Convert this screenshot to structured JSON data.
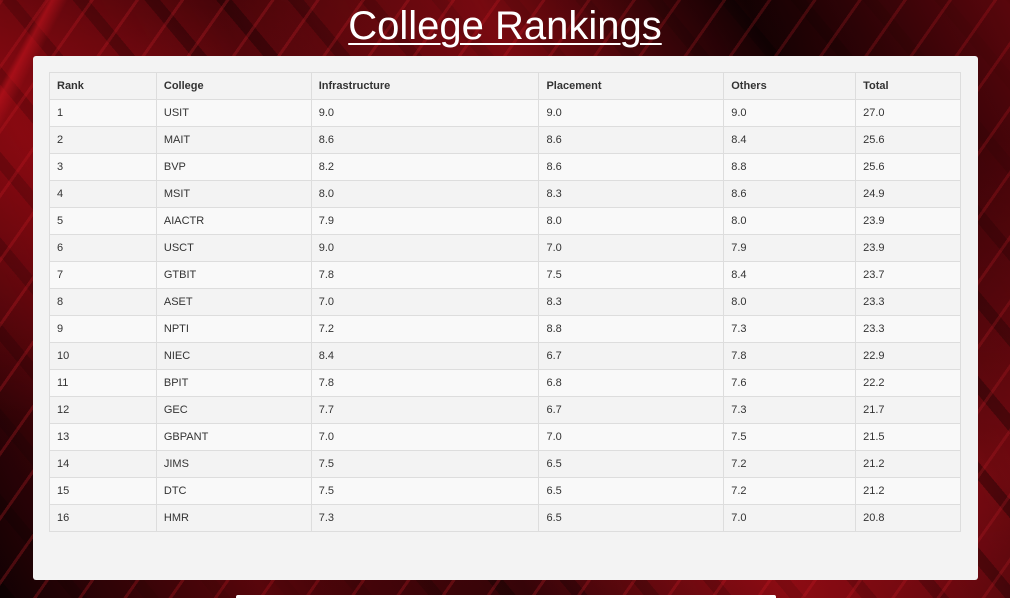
{
  "page": {
    "title": "College Rankings"
  },
  "table": {
    "headers": [
      "Rank",
      "College",
      "Infrastructure",
      "Placement",
      "Others",
      "Total"
    ],
    "rows": [
      [
        "1",
        "USIT",
        "9.0",
        "9.0",
        "9.0",
        "27.0"
      ],
      [
        "2",
        "MAIT",
        "8.6",
        "8.6",
        "8.4",
        "25.6"
      ],
      [
        "3",
        "BVP",
        "8.2",
        "8.6",
        "8.8",
        "25.6"
      ],
      [
        "4",
        "MSIT",
        "8.0",
        "8.3",
        "8.6",
        "24.9"
      ],
      [
        "5",
        "AIACTR",
        "7.9",
        "8.0",
        "8.0",
        "23.9"
      ],
      [
        "6",
        "USCT",
        "9.0",
        "7.0",
        "7.9",
        "23.9"
      ],
      [
        "7",
        "GTBIT",
        "7.8",
        "7.5",
        "8.4",
        "23.7"
      ],
      [
        "8",
        "ASET",
        "7.0",
        "8.3",
        "8.0",
        "23.3"
      ],
      [
        "9",
        "NPTI",
        "7.2",
        "8.8",
        "7.3",
        "23.3"
      ],
      [
        "10",
        "NIEC",
        "8.4",
        "6.7",
        "7.8",
        "22.9"
      ],
      [
        "11",
        "BPIT",
        "7.8",
        "6.8",
        "7.6",
        "22.2"
      ],
      [
        "12",
        "GEC",
        "7.7",
        "6.7",
        "7.3",
        "21.7"
      ],
      [
        "13",
        "GBPANT",
        "7.0",
        "7.0",
        "7.5",
        "21.5"
      ],
      [
        "14",
        "JIMS",
        "7.5",
        "6.5",
        "7.2",
        "21.2"
      ],
      [
        "15",
        "DTC",
        "7.5",
        "6.5",
        "7.2",
        "21.2"
      ],
      [
        "16",
        "HMR",
        "7.3",
        "6.5",
        "7.0",
        "20.8"
      ]
    ]
  },
  "colors": {
    "background_accent": "#b0101c",
    "panel": "#f3f3f3",
    "row_odd": "#f9f9f9",
    "row_even": "#f3f3f3",
    "border": "#dddddd",
    "title": "#ffffff"
  }
}
